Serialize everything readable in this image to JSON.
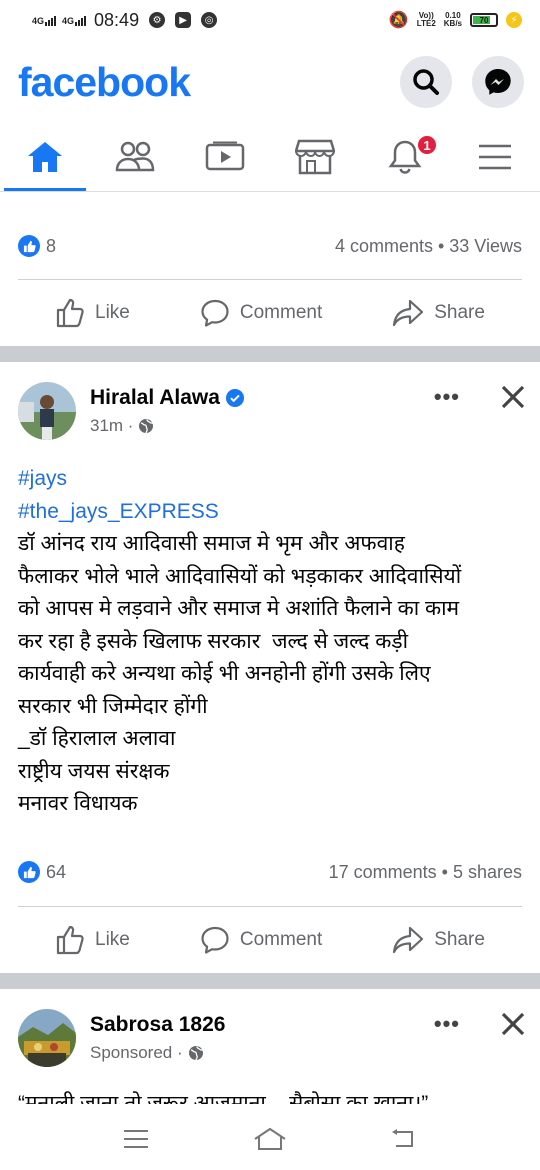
{
  "status_bar": {
    "network_1": "4G",
    "network_2": "4G",
    "time": "08:49",
    "volte_line1": "Vo))",
    "volte_line2": "LTE2",
    "speed_value": "0.10",
    "speed_unit": "KB/s",
    "battery": "70"
  },
  "header": {
    "logo": "facebook",
    "search_icon": "search-icon",
    "messenger_icon": "messenger-icon"
  },
  "nav": {
    "tabs": [
      {
        "name": "home",
        "icon": "home-icon",
        "active": true
      },
      {
        "name": "friends",
        "icon": "friends-icon"
      },
      {
        "name": "watch",
        "icon": "watch-icon"
      },
      {
        "name": "marketplace",
        "icon": "marketplace-icon"
      },
      {
        "name": "notifications",
        "icon": "bell-icon",
        "badge": "1"
      },
      {
        "name": "menu",
        "icon": "menu-icon"
      }
    ],
    "notification_badge": "1"
  },
  "post_prev": {
    "likes": "8",
    "stats": "4 comments • 33 Views"
  },
  "actions": {
    "like": "Like",
    "comment": "Comment",
    "share": "Share"
  },
  "post_1": {
    "author": "Hiralal Alawa",
    "time": "31m ·",
    "hashtag_1": "#jays",
    "hashtag_2": "#the_jays_EXPRESS",
    "line_1": "डॉ आंनद राय आदिवासी समाज मे भृम और अफवाह",
    "line_2": "फैलाकर भोले भाले आदिवासियों को भड़काकर आदिवासियों",
    "line_3": "को आपस मे लड़वाने और समाज मे अशांति फैलाने का काम",
    "line_4": "कर रहा है इसके खिलाफ सरकार  जल्द से जल्द कड़ी",
    "line_5": "कार्यवाही करे अन्यथा कोई भी अनहोनी होंगी उसके लिए",
    "line_6": "सरकार भी जिम्मेदार होंगी",
    "line_7": "_डॉ हिरालाल अलावा",
    "line_8": "राष्ट्रीय जयस संरक्षक",
    "line_9": "मनावर विधायक",
    "likes": "64",
    "stats": "17 comments • 5 shares"
  },
  "post_2": {
    "author": "Sabrosa 1826",
    "sponsored": "Sponsored ·",
    "text_start": "“मनाली जाना तो जरूर आजमाना... सैबोसा का खाना।”"
  },
  "colors": {
    "brand": "#1877f2",
    "text": "#050505",
    "secondary": "#65676b",
    "hashtag": "#216fdb",
    "badge": "#e41e3f",
    "separator": "#c9ccd1"
  }
}
